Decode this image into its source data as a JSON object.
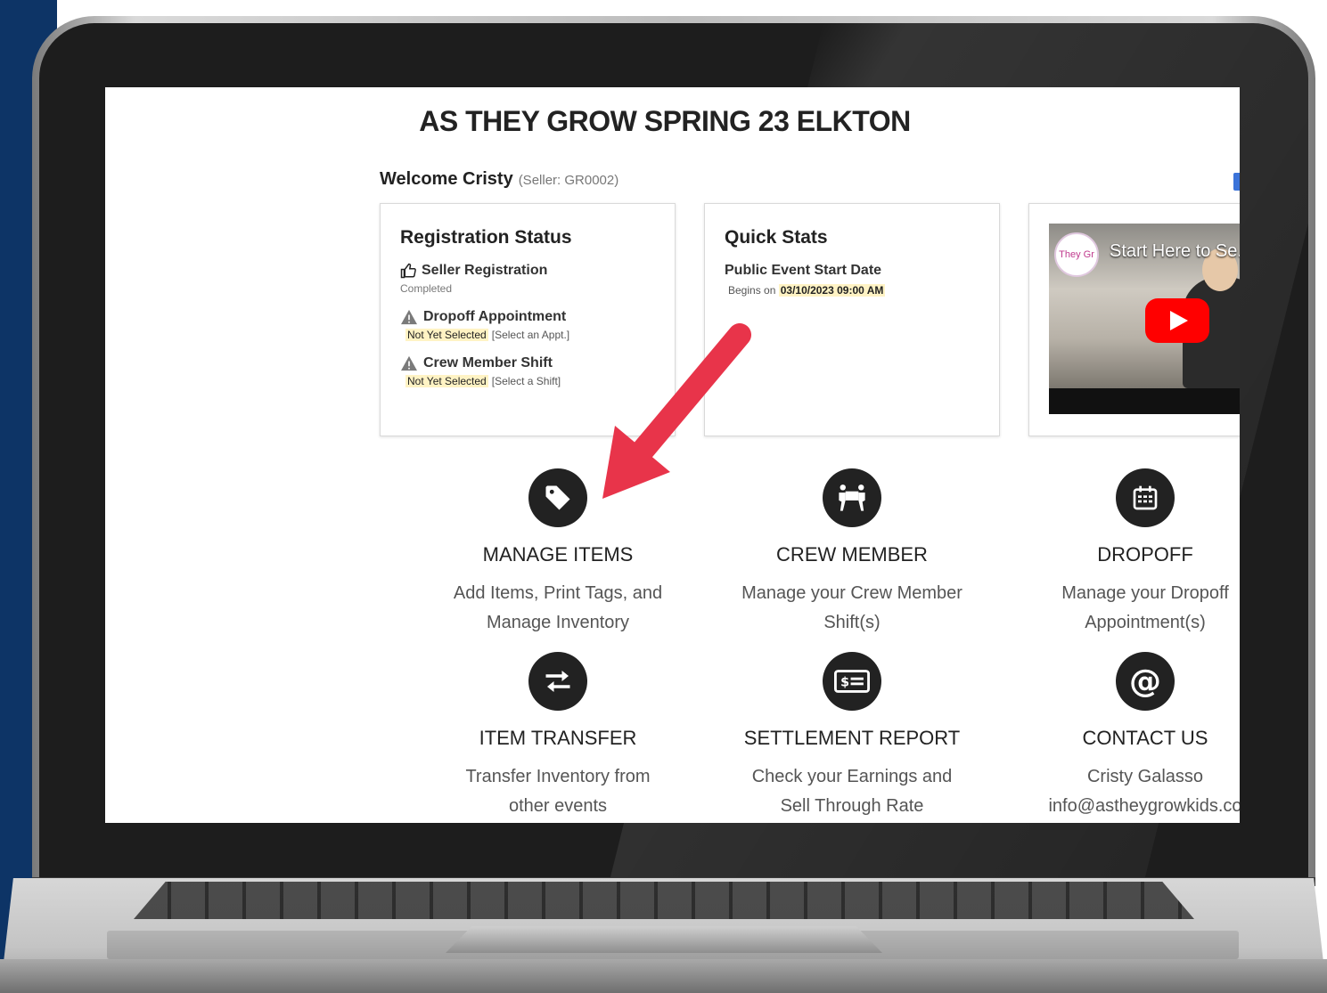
{
  "event": {
    "title": "AS THEY GROW SPRING 23 ELKTON"
  },
  "welcome": {
    "text": "Welcome Cristy",
    "seller": "(Seller: GR0002)"
  },
  "registration": {
    "title": "Registration Status",
    "items": [
      {
        "label": "Seller Registration",
        "status": "Completed",
        "icon": "thumbs-up-icon"
      },
      {
        "label": "Dropoff Appointment",
        "status": "Not Yet Selected",
        "action": "[Select an Appt.]",
        "icon": "warning-icon"
      },
      {
        "label": "Crew Member Shift",
        "status": "Not Yet Selected",
        "action": "[Select a Shift]",
        "icon": "warning-icon"
      }
    ]
  },
  "quick_stats": {
    "title": "Quick Stats",
    "label": "Public Event Start Date",
    "prefix": "Begins on",
    "value": "03/10/2023 09:00 AM"
  },
  "video": {
    "title": "Start Here to Se...",
    "logo_text": "They Gr"
  },
  "tiles": [
    {
      "title": "MANAGE ITEMS",
      "line1": "Add Items, Print Tags, and",
      "line2": "Manage Inventory",
      "icon": "tag-icon"
    },
    {
      "title": "CREW MEMBER",
      "line1": "Manage your Crew Member",
      "line2": "Shift(s)",
      "icon": "crew-icon"
    },
    {
      "title": "DROPOFF",
      "line1": "Manage your Dropoff",
      "line2": "Appointment(s)",
      "icon": "calendar-icon"
    },
    {
      "title": "ITEM TRANSFER",
      "line1": "Transfer Inventory from",
      "line2": "other events",
      "icon": "transfer-icon"
    },
    {
      "title": "SETTLEMENT REPORT",
      "line1": "Check your Earnings and",
      "line2": "Sell Through Rate",
      "icon": "money-icon"
    },
    {
      "title": "CONTACT US",
      "line1": "Cristy Galasso",
      "line2": "info@astheygrowkids.co",
      "icon": "at-icon"
    }
  ],
  "colors": {
    "arrow": "#e8344a",
    "navy": "#0d3466",
    "icon_bg": "#222222",
    "highlight": "#fff3c4"
  }
}
